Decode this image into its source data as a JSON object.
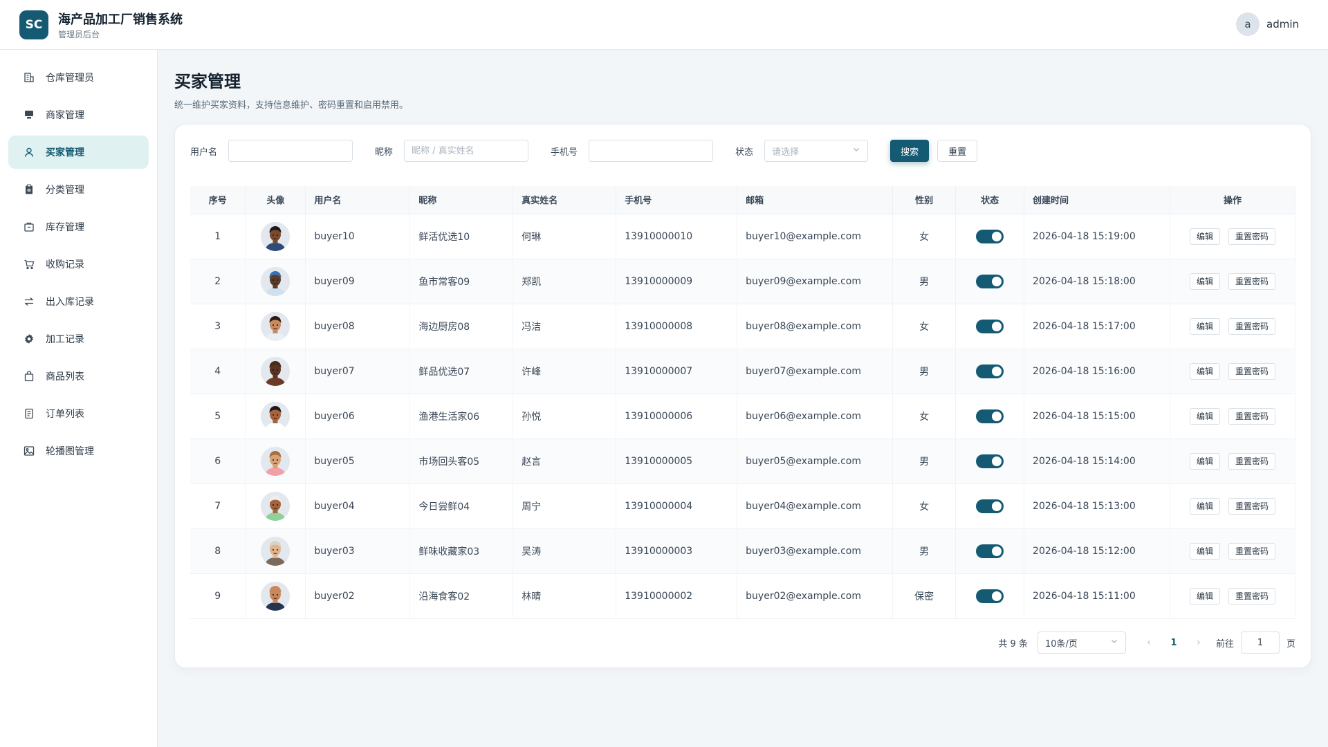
{
  "header": {
    "logo": "SC",
    "title": "海产品加工厂销售系统",
    "subtitle": "管理员后台",
    "user_avatar": "a",
    "user_name": "admin"
  },
  "sidebar": {
    "items": [
      {
        "label": "仓库管理员",
        "icon": "building-icon",
        "active": false
      },
      {
        "label": "商家管理",
        "icon": "store-icon",
        "active": false
      },
      {
        "label": "买家管理",
        "icon": "user-icon",
        "active": true
      },
      {
        "label": "分类管理",
        "icon": "clipboard-icon",
        "active": false
      },
      {
        "label": "库存管理",
        "icon": "box-icon",
        "active": false
      },
      {
        "label": "收购记录",
        "icon": "cart-icon",
        "active": false
      },
      {
        "label": "出入库记录",
        "icon": "transfer-icon",
        "active": false
      },
      {
        "label": "加工记录",
        "icon": "gear-icon",
        "active": false
      },
      {
        "label": "商品列表",
        "icon": "bag-icon",
        "active": false
      },
      {
        "label": "订单列表",
        "icon": "document-icon",
        "active": false
      },
      {
        "label": "轮播图管理",
        "icon": "image-icon",
        "active": false
      }
    ]
  },
  "page": {
    "title": "买家管理",
    "description": "统一维护买家资料，支持信息维护、密码重置和启用禁用。"
  },
  "filters": {
    "username_label": "用户名",
    "username_value": "",
    "nickname_label": "昵称",
    "nickname_placeholder": "昵称 / 真实姓名",
    "phone_label": "手机号",
    "phone_value": "",
    "status_label": "状态",
    "status_placeholder": "请选择",
    "search_button": "搜索",
    "reset_button": "重置"
  },
  "table": {
    "columns": [
      "序号",
      "头像",
      "用户名",
      "昵称",
      "真实姓名",
      "手机号",
      "邮箱",
      "性别",
      "状态",
      "创建时间",
      "操作"
    ],
    "edit_label": "编辑",
    "reset_pwd_label": "重置密码",
    "rows": [
      {
        "no": "1",
        "username": "buyer10",
        "nickname": "鲜活优选10",
        "realname": "何琳",
        "phone": "13910000010",
        "email": "buyer10@example.com",
        "gender": "女",
        "enabled": true,
        "created": "2026-04-18 15:19:00",
        "skin": "#7a4a2c",
        "hair": "#1e1a18",
        "shirt": "#2f4b7a"
      },
      {
        "no": "2",
        "username": "buyer09",
        "nickname": "鱼市常客09",
        "realname": "郑凯",
        "phone": "13910000009",
        "email": "buyer09@example.com",
        "gender": "男",
        "enabled": true,
        "created": "2026-04-18 15:18:00",
        "skin": "#5b3a26",
        "hair": "#3a6fb0",
        "shirt": "#cfe0f0"
      },
      {
        "no": "3",
        "username": "buyer08",
        "nickname": "海边厨房08",
        "realname": "冯洁",
        "phone": "13910000008",
        "email": "buyer08@example.com",
        "gender": "女",
        "enabled": true,
        "created": "2026-04-18 15:17:00",
        "skin": "#c98a5e",
        "hair": "#2a1d16",
        "shirt": "#eaf0f6"
      },
      {
        "no": "4",
        "username": "buyer07",
        "nickname": "鲜品优选07",
        "realname": "许峰",
        "phone": "13910000007",
        "email": "buyer07@example.com",
        "gender": "男",
        "enabled": true,
        "created": "2026-04-18 15:16:00",
        "skin": "#5a3322",
        "hair": "#4a2a1c",
        "shirt": "#6b3b28"
      },
      {
        "no": "5",
        "username": "buyer06",
        "nickname": "渔港生活家06",
        "realname": "孙悦",
        "phone": "13910000006",
        "email": "buyer06@example.com",
        "gender": "女",
        "enabled": true,
        "created": "2026-04-18 15:15:00",
        "skin": "#a8623c",
        "hair": "#1e1a18",
        "shirt": "#ffffff"
      },
      {
        "no": "6",
        "username": "buyer05",
        "nickname": "市场回头客05",
        "realname": "赵言",
        "phone": "13910000005",
        "email": "buyer05@example.com",
        "gender": "男",
        "enabled": true,
        "created": "2026-04-18 15:14:00",
        "skin": "#d9a275",
        "hair": "#a5703f",
        "shirt": "#f2a0a8"
      },
      {
        "no": "7",
        "username": "buyer04",
        "nickname": "今日尝鲜04",
        "realname": "周宁",
        "phone": "13910000004",
        "email": "buyer04@example.com",
        "gender": "女",
        "enabled": true,
        "created": "2026-04-18 15:13:00",
        "skin": "#a5633b",
        "hair": "#eeeeee",
        "shirt": "#8ed19b"
      },
      {
        "no": "8",
        "username": "buyer03",
        "nickname": "鲜味收藏家03",
        "realname": "吴涛",
        "phone": "13910000003",
        "email": "buyer03@example.com",
        "gender": "男",
        "enabled": true,
        "created": "2026-04-18 15:12:00",
        "skin": "#e0b58e",
        "hair": "#d9d3c7",
        "shirt": "#7a6a5a"
      },
      {
        "no": "9",
        "username": "buyer02",
        "nickname": "沿海食客02",
        "realname": "林晴",
        "phone": "13910000002",
        "email": "buyer02@example.com",
        "gender": "保密",
        "enabled": true,
        "created": "2026-04-18 15:11:00",
        "skin": "#c9875b",
        "hair": "#c9875b",
        "shirt": "#24364f"
      }
    ]
  },
  "pagination": {
    "total": "共 9 条",
    "page_size": "10条/页",
    "current_page": "1",
    "goto_label": "前往",
    "goto_value": "1",
    "page_suffix": "页"
  },
  "colors": {
    "primary": "#155a73",
    "active_bg": "#dff1f1"
  }
}
